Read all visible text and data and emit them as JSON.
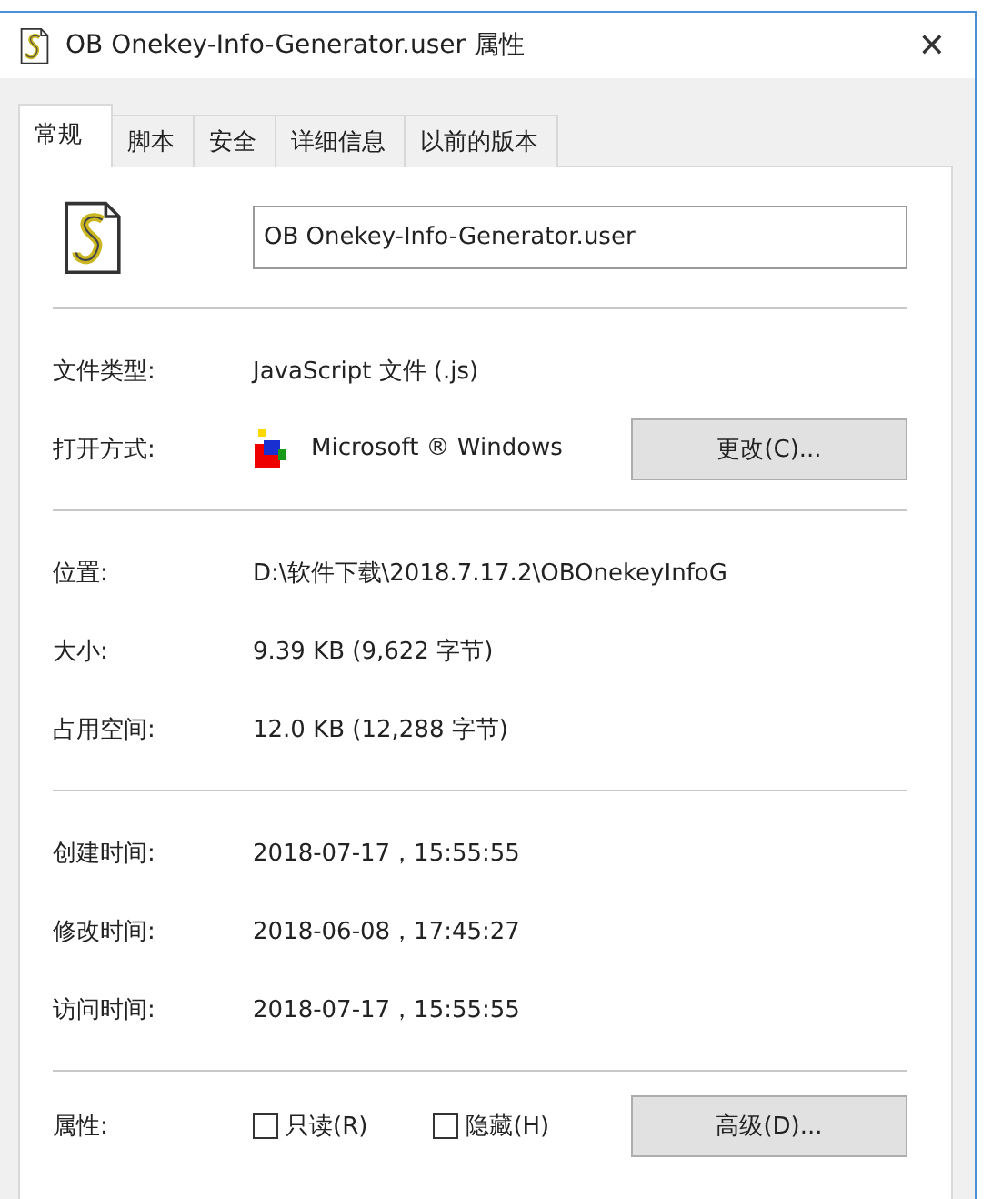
{
  "window": {
    "title": "OB Onekey-Info-Generator.user 属性",
    "close": "✕"
  },
  "tabs": [
    {
      "label": "常规",
      "selected": true
    },
    {
      "label": "脚本",
      "selected": false
    },
    {
      "label": "安全",
      "selected": false
    },
    {
      "label": "详细信息",
      "selected": false
    },
    {
      "label": "以前的版本",
      "selected": false
    }
  ],
  "file_name": {
    "value": "OB Onekey-Info-Generator.user"
  },
  "sections": [
    [
      {
        "label": "文件类型:",
        "value": "JavaScript 文件 (.js)"
      },
      {
        "label": "打开方式:",
        "value": "Microsoft ® Windows",
        "button": "更改(C)..."
      }
    ],
    [
      {
        "label": "位置:",
        "value": "D:\\软件下载\\2018.7.17.2\\OBOnekeyInfoG"
      },
      {
        "label": "大小:",
        "value": "9.39 KB (9,622 字节)"
      },
      {
        "label": "占用空间:",
        "value": "12.0 KB (12,288 字节)"
      }
    ],
    [
      {
        "label": "创建时间:",
        "value": "2018-07-17，15:55:55"
      },
      {
        "label": "修改时间:",
        "value": "2018-06-08，17:45:27"
      },
      {
        "label": "访问时间:",
        "value": "2018-07-17，15:55:55"
      }
    ]
  ],
  "attributes": {
    "label": "属性:",
    "options": [
      {
        "label": "只读(R)",
        "checked": false
      },
      {
        "label": "隐藏(H)",
        "checked": false
      }
    ],
    "button": "高级(D)..."
  }
}
